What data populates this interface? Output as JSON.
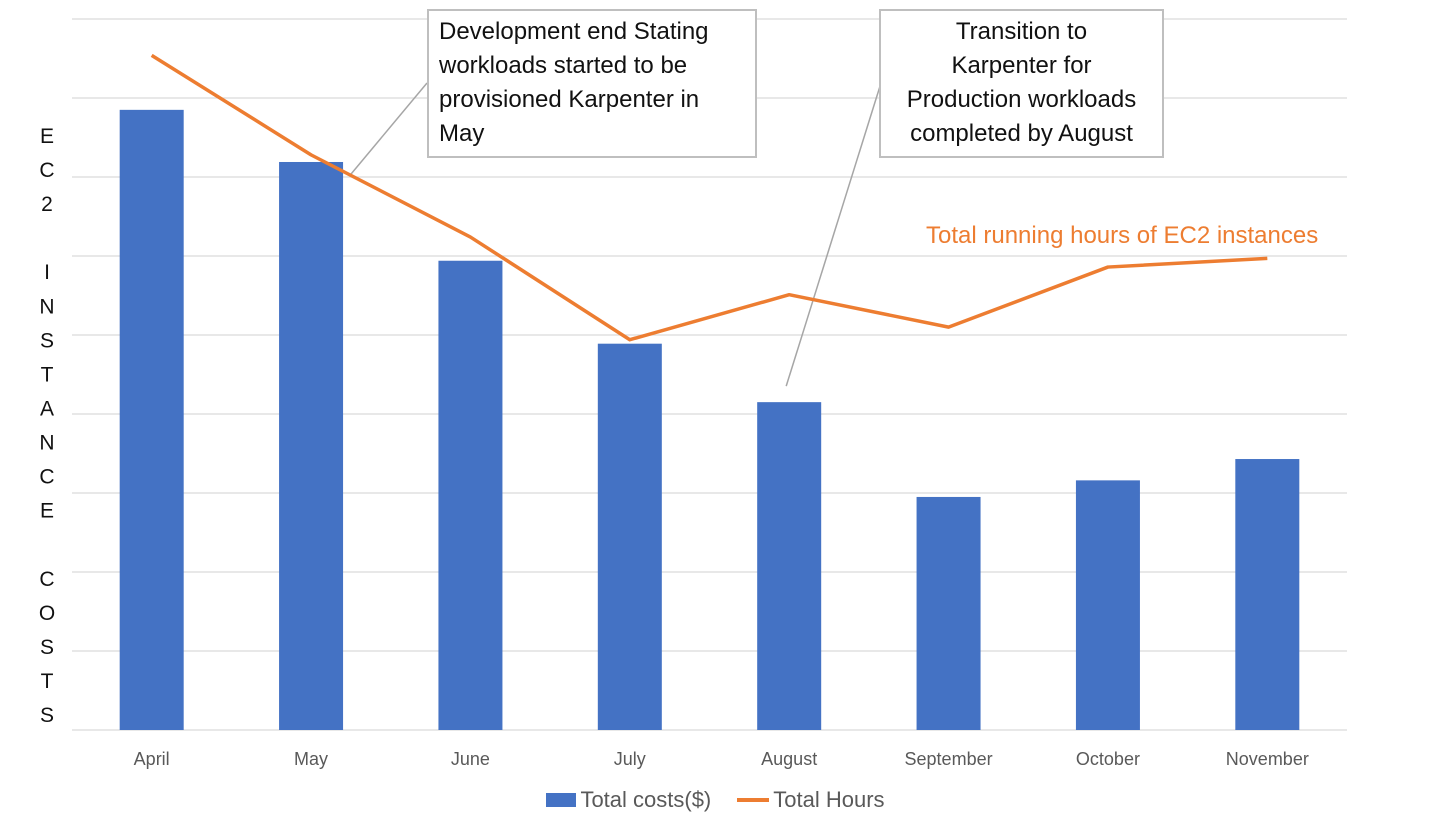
{
  "chart_data": {
    "type": "bar",
    "title": "",
    "xlabel": "",
    "ylabel": "EC2 INSTANCE COSTS",
    "ylabel_letters": [
      "E",
      "C",
      "2",
      "",
      "I",
      "N",
      "S",
      "T",
      "A",
      "N",
      "C",
      "E",
      "",
      "C",
      "O",
      "S",
      "T",
      "S"
    ],
    "y_tick_labels_visible": false,
    "ylim": [
      0,
      9
    ],
    "grid": true,
    "categories": [
      "April",
      "May",
      "June",
      "July",
      "August",
      "September",
      "October",
      "November"
    ],
    "series": [
      {
        "name": "Total costs($)",
        "type": "bar",
        "color": "#4472C4",
        "values": [
          7.85,
          7.19,
          5.94,
          4.89,
          4.15,
          2.95,
          3.16,
          3.43
        ]
      },
      {
        "name": "Total Hours",
        "type": "line",
        "color": "#ED7D31",
        "values": [
          8.54,
          7.28,
          6.24,
          4.94,
          5.51,
          5.1,
          5.86,
          5.97
        ]
      }
    ],
    "annotations": [
      {
        "text": "Development end Stating workloads started to be provisioned Karpenter in May",
        "points_to": "May"
      },
      {
        "text": "Transition to Karpenter for Production workloads completed by August",
        "points_to": "August"
      },
      {
        "text": "Total running hours of EC2 instances",
        "refers_to": "Total Hours"
      }
    ],
    "legend": {
      "position": "bottom",
      "entries": [
        "Total costs($)",
        "Total Hours"
      ]
    }
  },
  "callouts": {
    "c1_lines": [
      "Development end Stating",
      "workloads started to be",
      "provisioned Karpenter in",
      "May"
    ],
    "c2_lines": [
      "Transition to",
      "Karpenter for",
      "Production workloads",
      "completed by August"
    ],
    "series_label": "Total running hours of EC2 instances"
  },
  "legend": {
    "bar_label": "Total costs($)",
    "line_label": "Total Hours"
  }
}
